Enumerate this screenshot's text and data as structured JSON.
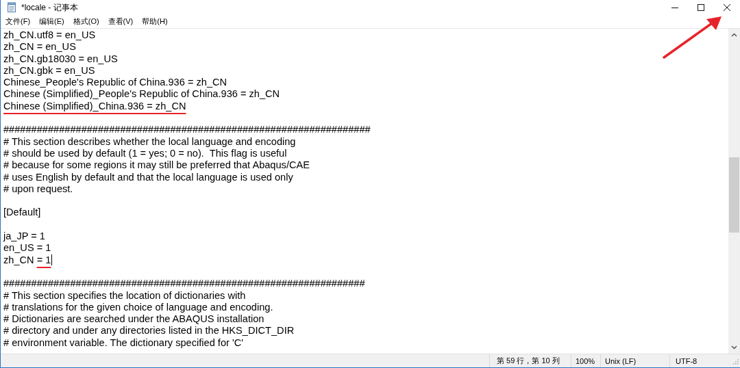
{
  "window": {
    "title": "*locale - 记事本"
  },
  "menu": [
    "文件(F)",
    "编辑(E)",
    "格式(O)",
    "查看(V)",
    "帮助(H)"
  ],
  "lines": [
    {
      "text": "zh_CN.utf8 = en_US"
    },
    {
      "text": "zh_CN = en_US"
    },
    {
      "text": "zh_CN.gb18030 = en_US"
    },
    {
      "text": "zh_CN.gbk = en_US"
    },
    {
      "text": "Chinese_People's Republic of China.936 = zh_CN"
    },
    {
      "text": "Chinese (Simplified)_People's Republic of China.936 = zh_CN"
    },
    {
      "marked": "Chinese (Simplified)_China.936 = zh_CN"
    },
    {
      "text": "##################################################################",
      "gap_before": true
    },
    {
      "text": "# This section describes whether the local language and encoding"
    },
    {
      "text": "# should be used by default (1 = yes; 0 = no).  This flag is useful"
    },
    {
      "text": "# because for some regions it may still be preferred that Abaqus/CAE"
    },
    {
      "text": "# uses English by default and that the local language is used only"
    },
    {
      "text": "# upon request."
    },
    {
      "text": "[Default]",
      "gap_before": true
    },
    {
      "text": "ja_JP = 1",
      "gap_before": true
    },
    {
      "text": "en_US = 1"
    },
    {
      "text": "zh_CN ",
      "marked": "= 1",
      "caret": true
    },
    {
      "text": "#################################################################",
      "gap_before": true
    },
    {
      "text": "# This section specifies the location of dictionaries with"
    },
    {
      "text": "# translations for the given choice of language and encoding."
    },
    {
      "text": "# Dictionaries are searched under the ABAQUS installation"
    },
    {
      "text": "# directory and under any directories listed in the HKS_DICT_DIR"
    },
    {
      "text": "# environment variable. The dictionary specified for 'C'"
    }
  ],
  "status_bar": {
    "position": "第 59 行，第 10 列",
    "zoom": "100%",
    "line_ending": "Unix (LF)",
    "encoding": "UTF-8"
  }
}
